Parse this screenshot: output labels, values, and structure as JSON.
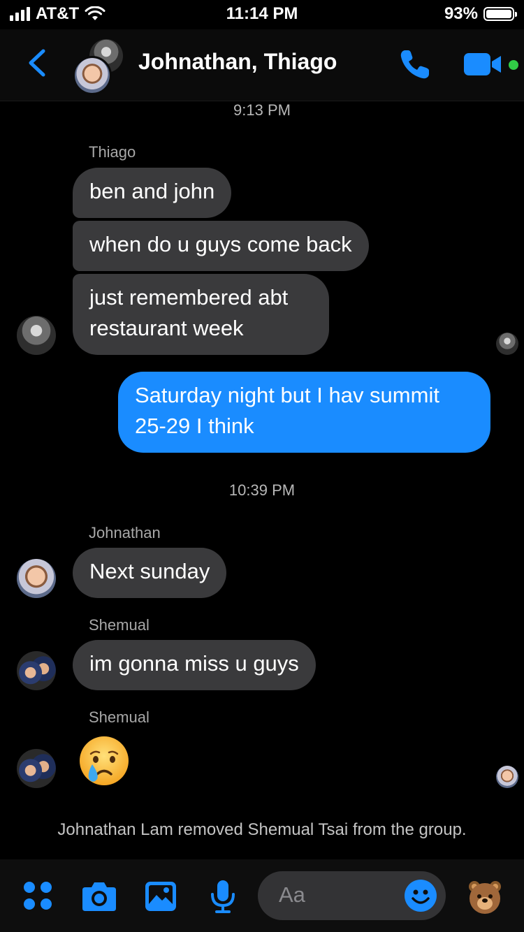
{
  "statusbar": {
    "carrier": "AT&T",
    "time": "11:14 PM",
    "battery": "93%",
    "battery_level": 0.93,
    "icons": [
      "signal-icon",
      "wifi-icon",
      "battery-icon"
    ]
  },
  "header": {
    "title": "Johnathan, Thiago",
    "icons": [
      "back-icon",
      "phone-icon",
      "video-icon"
    ],
    "accent_color": "#1a8cff",
    "online_color": "#31cc46"
  },
  "messages": {
    "time1": "9:13 PM",
    "sender_thiago": "Thiago",
    "msg1": "ben and john",
    "msg2": "when do u guys come back",
    "msg3": "just remembered abt\nrestaurant week",
    "msg4_out": "Saturday night but I hav summit\n25-29 I think",
    "time2": "10:39 PM",
    "sender_johnathan": "Johnathan",
    "msg5": "Next sunday",
    "sender_shemual_1": "Shemual",
    "msg6": "im gonna miss u guys",
    "sender_shemual_2": "Shemual",
    "msg7_emoji": "crying-face-emoji",
    "notice": "Johnathan Lam removed Shemual Tsai from the group."
  },
  "composer": {
    "placeholder": "Aa",
    "icons": [
      "apps-icon",
      "camera-icon",
      "gallery-icon",
      "microphone-icon",
      "emoji-icon",
      "bear-sticker-icon"
    ]
  },
  "colors": {
    "incoming_bubble": "#3a3a3c",
    "outgoing_bubble": "#1a8cff",
    "background": "#000000"
  }
}
